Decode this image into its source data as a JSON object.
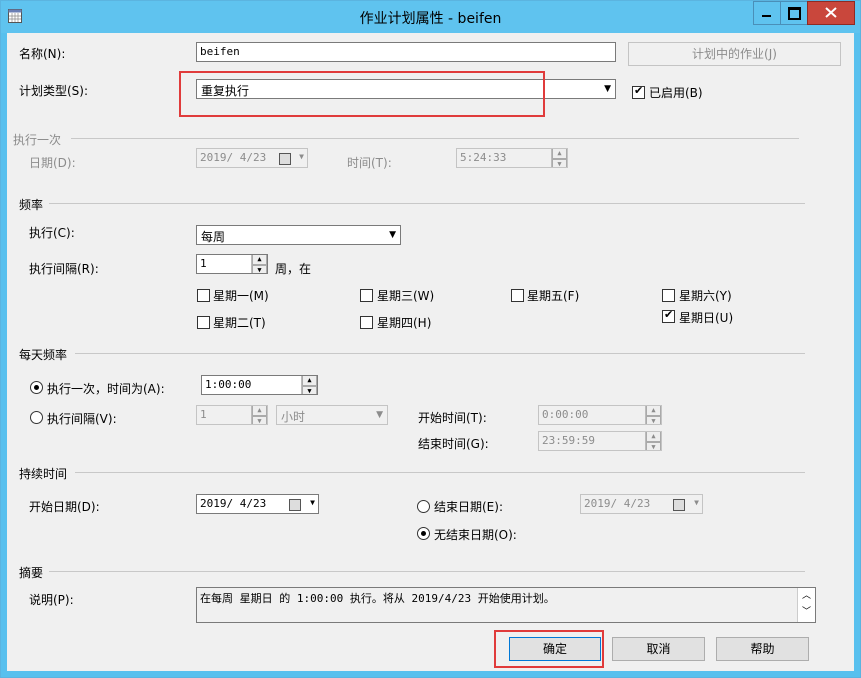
{
  "window": {
    "title": "作业计划属性 - beifen"
  },
  "name": {
    "label": "名称(N):",
    "value": "beifen"
  },
  "jobs_button": "计划中的作业(J)",
  "schedule_type": {
    "label": "计划类型(S):",
    "value": "重复执行"
  },
  "enabled": {
    "label": "已启用(B)",
    "checked": true
  },
  "once": {
    "section": "执行一次",
    "date_label": "日期(D):",
    "date_value": "2019/ 4/23",
    "time_label": "时间(T):",
    "time_value": "5:24:33"
  },
  "frequency": {
    "section": "频率",
    "occurs_label": "执行(C):",
    "occurs_value": "每周",
    "recurs_label": "执行间隔(R):",
    "recurs_value": "1",
    "recurs_unit": "周，在",
    "days": [
      {
        "label": "星期一(M)",
        "checked": false
      },
      {
        "label": "星期三(W)",
        "checked": false
      },
      {
        "label": "星期五(F)",
        "checked": false
      },
      {
        "label": "星期六(Y)",
        "checked": false
      },
      {
        "label": "星期二(T)",
        "checked": false
      },
      {
        "label": "星期四(H)",
        "checked": false
      },
      {
        "label": "星期日(U)",
        "checked": true
      }
    ]
  },
  "daily": {
    "section": "每天频率",
    "once_label": "执行一次，时间为(A):",
    "once_value": "1:00:00",
    "every_label": "执行间隔(V):",
    "every_value": "1",
    "every_unit": "小时",
    "start_label": "开始时间(T):",
    "start_value": "0:00:00",
    "end_label": "结束时间(G):",
    "end_value": "23:59:59"
  },
  "duration": {
    "section": "持续时间",
    "start_label": "开始日期(D):",
    "start_value": "2019/ 4/23",
    "end_label": "结束日期(E):",
    "end_value": "2019/ 4/23",
    "noend_label": "无结束日期(O):"
  },
  "summary": {
    "section": "摘要",
    "desc_label": "说明(P):",
    "desc_value": "在每周 星期日 的 1:00:00 执行。将从 2019/4/23 开始使用计划。"
  },
  "buttons": {
    "ok": "确定",
    "cancel": "取消",
    "help": "帮助"
  }
}
